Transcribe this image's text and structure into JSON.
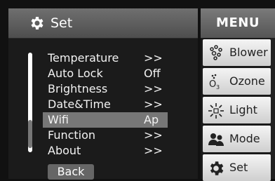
{
  "header": {
    "title": "Set"
  },
  "settings": {
    "items": [
      {
        "label": "Temperature",
        "value": ">>"
      },
      {
        "label": "Auto Lock",
        "value": "Off"
      },
      {
        "label": "Brightness",
        "value": ">>"
      },
      {
        "label": "Date&Time",
        "value": ">>"
      },
      {
        "label": "Wifi",
        "value": "Ap"
      },
      {
        "label": "Function",
        "value": ">>"
      },
      {
        "label": "About",
        "value": ">>"
      }
    ],
    "selected_label": "Wifi",
    "back_label": "Back"
  },
  "menu": {
    "title": "MENU",
    "items": [
      {
        "label": "Blower",
        "icon": "blower-icon"
      },
      {
        "label": "Ozone",
        "icon": "ozone-icon"
      },
      {
        "label": "Light",
        "icon": "light-icon"
      },
      {
        "label": "Mode",
        "icon": "mode-icon"
      },
      {
        "label": "Set",
        "icon": "gear-icon"
      }
    ]
  },
  "colors": {
    "background": "#111111",
    "header": "#5e5e5e",
    "selected_row": "#777777",
    "menu_item": "#e6e6e6"
  }
}
